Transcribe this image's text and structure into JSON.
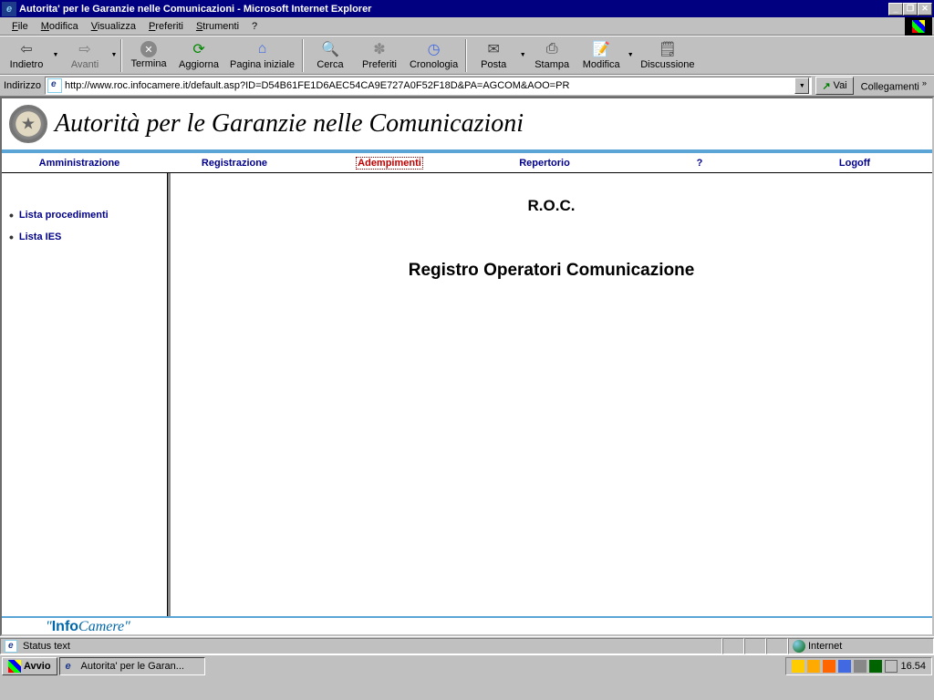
{
  "window": {
    "title": "Autorita' per le Garanzie nelle Comunicazioni - Microsoft Internet Explorer"
  },
  "menubar": {
    "file": "File",
    "edit": "Modifica",
    "view": "Visualizza",
    "favorites": "Preferiti",
    "tools": "Strumenti",
    "help": "?"
  },
  "toolbar": {
    "back": "Indietro",
    "forward": "Avanti",
    "stop": "Termina",
    "refresh": "Aggiorna",
    "home": "Pagina iniziale",
    "search": "Cerca",
    "favorites": "Preferiti",
    "history": "Cronologia",
    "mail": "Posta",
    "print": "Stampa",
    "edit": "Modifica",
    "discuss": "Discussione"
  },
  "address": {
    "label": "Indirizzo",
    "url": "http://www.roc.infocamere.it/default.asp?ID=D54B61FE1D6AEC54CA9E727A0F52F18D&PA=AGCOM&AOO=PR",
    "go": "Vai",
    "links": "Collegamenti"
  },
  "page": {
    "banner_title": "Autorità per le Garanzie nelle Comunicazioni",
    "nav": {
      "admin": "Amministrazione",
      "register": "Registrazione",
      "compliance": "Adempimenti",
      "repertory": "Repertorio",
      "help": "?",
      "logoff": "Logoff"
    },
    "sidebar": {
      "items": [
        {
          "label": "Lista procedimenti"
        },
        {
          "label": "Lista IES"
        }
      ]
    },
    "main": {
      "heading": "R.O.C.",
      "subheading": "Registro Operatori Comunicazione"
    },
    "footer_brand_pre": "\"",
    "footer_brand_bold": "Info",
    "footer_brand_rest": "Camere\""
  },
  "status": {
    "text": "Status text",
    "zone": "Internet"
  },
  "taskbar": {
    "start": "Avvio",
    "task": "Autorita' per le Garan...",
    "clock": "16.54"
  }
}
